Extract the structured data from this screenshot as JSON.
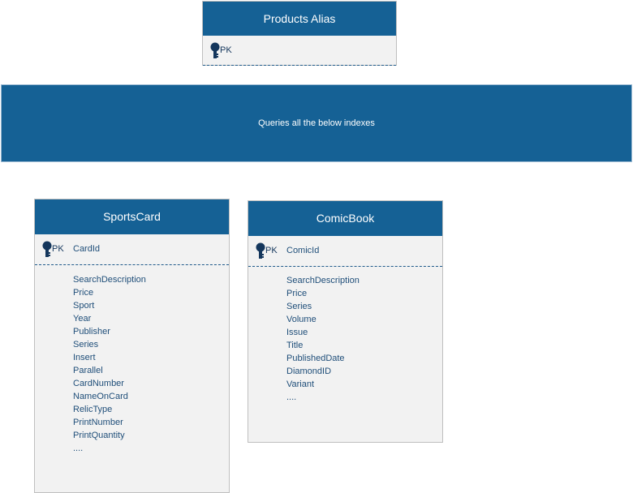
{
  "alias": {
    "title": "Products Alias",
    "pk_label": "PK"
  },
  "banner": {
    "text": "Queries all the below indexes"
  },
  "sportscard": {
    "title": "SportsCard",
    "pk_label": "PK",
    "pk_field": "CardId",
    "fields": [
      "SearchDescription",
      "Price",
      "Sport",
      "Year",
      "Publisher",
      "Series",
      "Insert",
      "Parallel",
      "CardNumber",
      "NameOnCard",
      "RelicType",
      "PrintNumber",
      "PrintQuantity",
      "...."
    ]
  },
  "comicbook": {
    "title": "ComicBook",
    "pk_label": "PK",
    "pk_field": "ComicId",
    "fields": [
      "SearchDescription",
      "Price",
      "Series",
      "Volume",
      "Issue",
      "Title",
      "PublishedDate",
      "DiamondID",
      "Variant",
      "...."
    ]
  },
  "colors": {
    "header": "#156195",
    "body": "#f2f2f2",
    "text": "#1f4e79"
  },
  "icons": {
    "primary_key": "key-icon"
  }
}
